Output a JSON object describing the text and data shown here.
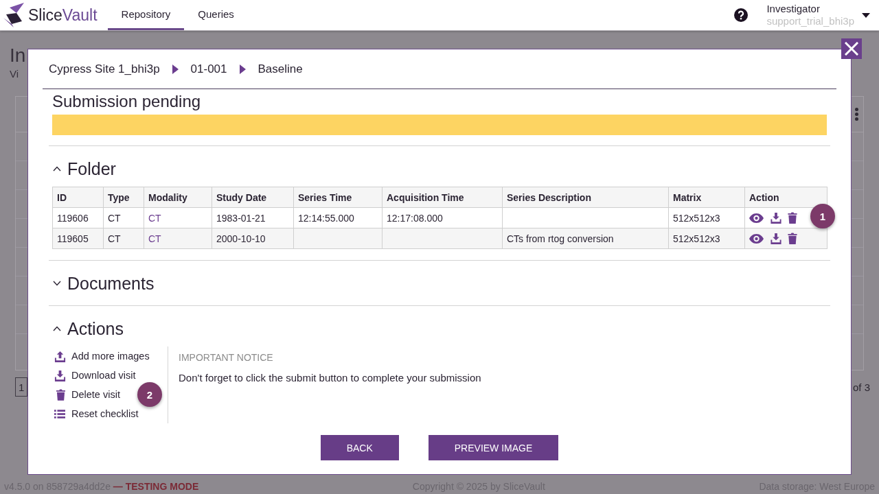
{
  "app_header": {
    "brand": {
      "name_start": "Slice",
      "name_end": "Vault"
    },
    "nav": [
      {
        "label": "Repository",
        "selected": true
      },
      {
        "label": "Queries",
        "selected": false
      }
    ],
    "user": {
      "role": "Investigator",
      "username": "support_trial_bhi3p"
    }
  },
  "background_page": {
    "title": "In",
    "subtitle": "Vi",
    "pagination": {
      "current_page": "1",
      "page_count": "of 3"
    }
  },
  "dialog": {
    "breadcrumb": [
      "Cypress Site 1_bhi3p",
      "01-001",
      "Baseline"
    ],
    "status_heading": "Submission pending",
    "sections": [
      {
        "kind": "table",
        "title": "Folder",
        "expanded": true,
        "columns": [
          {
            "label": "ID",
            "kind": "text"
          },
          {
            "label": "Type",
            "kind": "text"
          },
          {
            "label": "Modality",
            "kind": "link"
          },
          {
            "label": "Study Date",
            "kind": "text"
          },
          {
            "label": "Series Time",
            "kind": "text"
          },
          {
            "label": "Acquisition Time",
            "kind": "text"
          },
          {
            "label": "Series Description",
            "kind": "text"
          },
          {
            "label": "Matrix",
            "kind": "text"
          },
          {
            "label": "Action",
            "kind": "actions"
          }
        ],
        "rows": [
          {
            "cells": [
              "119606",
              "CT",
              "CT",
              "1983-01-21",
              "12:14:55.000",
              "12:17:08.000",
              null,
              "512x512x3"
            ],
            "marker": "1"
          },
          {
            "cells": [
              "119605",
              "CT",
              "CT",
              "2000-10-10",
              null,
              null,
              "CTs from rtog conversion",
              "512x512x3"
            ]
          }
        ]
      },
      {
        "title": "Documents",
        "expanded": false
      },
      {
        "kind": "actions",
        "title": "Actions",
        "expanded": true,
        "items": [
          {
            "kind": "upload",
            "label": "Add more images"
          },
          {
            "kind": "download",
            "label": "Download visit"
          },
          {
            "kind": "delete",
            "label": "Delete visit",
            "marker": "2"
          },
          {
            "kind": "checklist",
            "label": "Reset checklist"
          }
        ],
        "notice": {
          "title": "IMPORTANT NOTICE",
          "text": "Don't forget to click the submit button to complete your submission"
        }
      }
    ],
    "buttons": [
      "BACK",
      "PREVIEW IMAGE"
    ]
  },
  "footer": {
    "version": "v4.5.0 on 858729a4dd2e",
    "mode": "— TESTING MODE",
    "copyright": "Copyright © 2025 by SliceVault",
    "storage": "Data storage: West Europe"
  }
}
